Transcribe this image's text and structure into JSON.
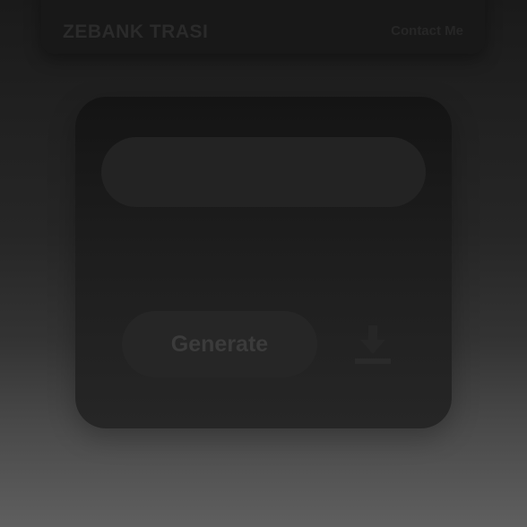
{
  "header": {
    "brand": "ZEBANK TRASI",
    "contact_label": "Contact Me"
  },
  "generator": {
    "prompt_placeholder": "",
    "generate_label": "Generate",
    "download_icon": "download-icon"
  },
  "colors": {
    "background_top": "#1a1a1a",
    "background_bottom": "#5f5f5f",
    "card": "#1d1d1d",
    "button": "#262626",
    "text_muted": "#3b3b3b"
  }
}
